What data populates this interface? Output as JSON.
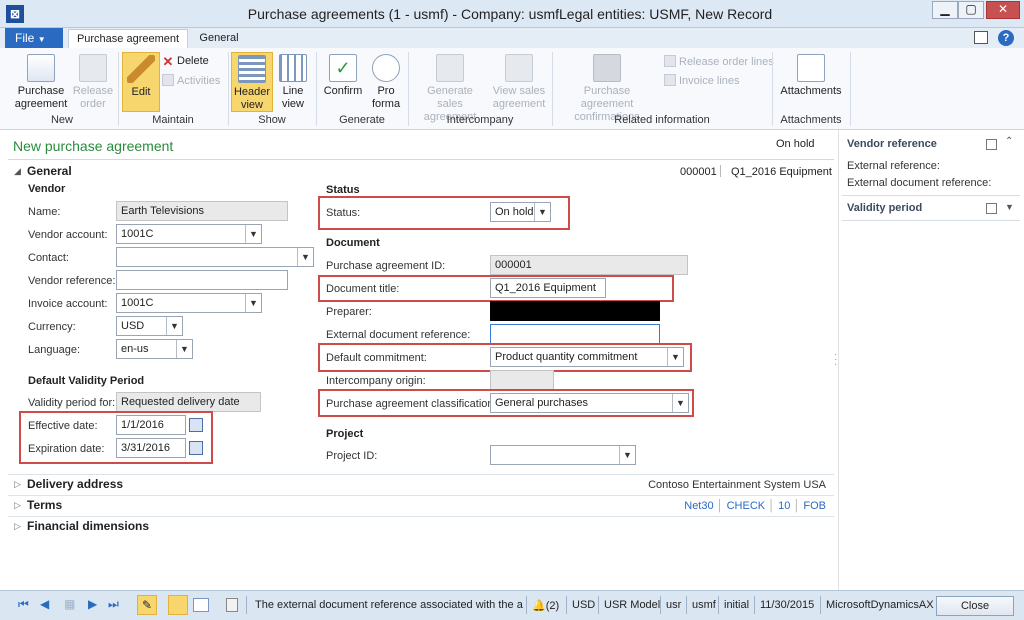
{
  "window": {
    "title": "Purchase agreements (1 - usmf) - Company: usmfLegal entities: USMF, New Record",
    "app_icon": "ax-app-icon"
  },
  "tabs": {
    "file": "File",
    "active": "Purchase agreement",
    "general": "General"
  },
  "ribbon": {
    "new": {
      "purchase_agreement": "Purchase agreement",
      "release_order": "Release order",
      "group": "New"
    },
    "maintain": {
      "edit": "Edit",
      "delete": "Delete",
      "activities": "Activities",
      "group": "Maintain"
    },
    "show": {
      "header_view": "Header view",
      "line_view": "Line view",
      "group": "Show"
    },
    "generate": {
      "confirm": "Confirm",
      "pro_forma": "Pro forma",
      "group": "Generate"
    },
    "intercompany": {
      "gen_sales": "Generate sales agreement",
      "view_sales": "View sales agreement",
      "group": "Intercompany"
    },
    "related": {
      "confirmations": "Purchase agreement confirmations",
      "release_order_lines": "Release order lines",
      "invoice_lines": "Invoice lines",
      "group": "Related information"
    },
    "attachments": {
      "attachments": "Attachments",
      "group": "Attachments"
    }
  },
  "header": {
    "title": "New purchase agreement",
    "status": "On hold",
    "id": "000001",
    "doc_title": "Q1_2016 Equipment"
  },
  "general": {
    "section": "General",
    "vendor_label": "Vendor",
    "name_label": "Name:",
    "name": "Earth Televisions",
    "vendor_account_label": "Vendor account:",
    "vendor_account": "1001C",
    "contact_label": "Contact:",
    "contact": "",
    "vendor_reference_label": "Vendor reference:",
    "vendor_reference": "",
    "invoice_account_label": "Invoice account:",
    "invoice_account": "1001C",
    "currency_label": "Currency:",
    "currency": "USD",
    "language_label": "Language:",
    "language": "en-us",
    "validity_label": "Default Validity Period",
    "validity_for_label": "Validity period for:",
    "validity_for": "Requested delivery date",
    "effective_label": "Effective date:",
    "effective": "1/1/2016",
    "expiration_label": "Expiration date:",
    "expiration": "3/31/2016",
    "status_section": "Status",
    "status_label": "Status:",
    "status": "On hold",
    "document_section": "Document",
    "pa_id_label": "Purchase agreement ID:",
    "pa_id": "000001",
    "doc_title_label": "Document title:",
    "doc_title": "Q1_2016 Equipment",
    "preparer_label": "Preparer:",
    "ext_doc_ref_label": "External document reference:",
    "ext_doc_ref": "",
    "commitment_label": "Default commitment:",
    "commitment": "Product quantity commitment",
    "ic_origin_label": "Intercompany origin:",
    "ic_origin": "",
    "classification_label": "Purchase agreement classification:",
    "classification": "General purchases",
    "project_section": "Project",
    "project_id_label": "Project ID:",
    "project_id": ""
  },
  "fasttabs": {
    "delivery": {
      "name": "Delivery address",
      "summary": "Contoso Entertainment System USA"
    },
    "terms": {
      "name": "Terms",
      "s1": "Net30",
      "s2": "CHECK",
      "s3": "10",
      "s4": "FOB"
    },
    "financial": {
      "name": "Financial dimensions"
    }
  },
  "factbox": {
    "vendor_reference": "Vendor reference",
    "external_reference": "External reference:",
    "external_doc_reference": "External document reference:",
    "validity_period": "Validity period"
  },
  "statusbar": {
    "message": "The external document reference associated with the a...",
    "alerts": "(2)",
    "currency": "USD",
    "model": "USR Model",
    "layer": "usr",
    "company": "usmf",
    "partition": "initial",
    "date": "11/30/2015",
    "instance": "MicrosoftDynamicsAX",
    "close": "Close"
  },
  "colors": {
    "accent": "#2a6bc1",
    "highlight": "#d04a4a",
    "title_green": "#2a8c3d",
    "ribbon_active": "#f8d66e"
  }
}
